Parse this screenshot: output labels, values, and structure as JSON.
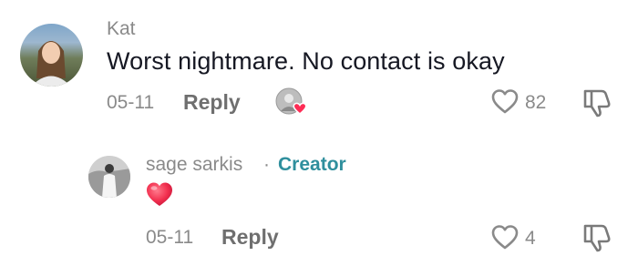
{
  "comment": {
    "username": "Kat",
    "text": "Worst nightmare. No contact is okay",
    "date": "05-11",
    "reply_label": "Reply",
    "like_count": "82"
  },
  "reply": {
    "username": "sage sarkis",
    "separator": "·",
    "badge": "Creator",
    "emoji": "❤️",
    "date": "05-11",
    "reply_label": "Reply",
    "like_count": "4"
  },
  "colors": {
    "creator_accent": "#2f8f9d",
    "heart_red": "#fe2c55",
    "muted_text": "#8a8a8a"
  },
  "icons": {
    "like": "heart-outline-icon",
    "dislike": "thumbs-down-icon",
    "creator_liked": "creator-liked-avatar-icon"
  }
}
